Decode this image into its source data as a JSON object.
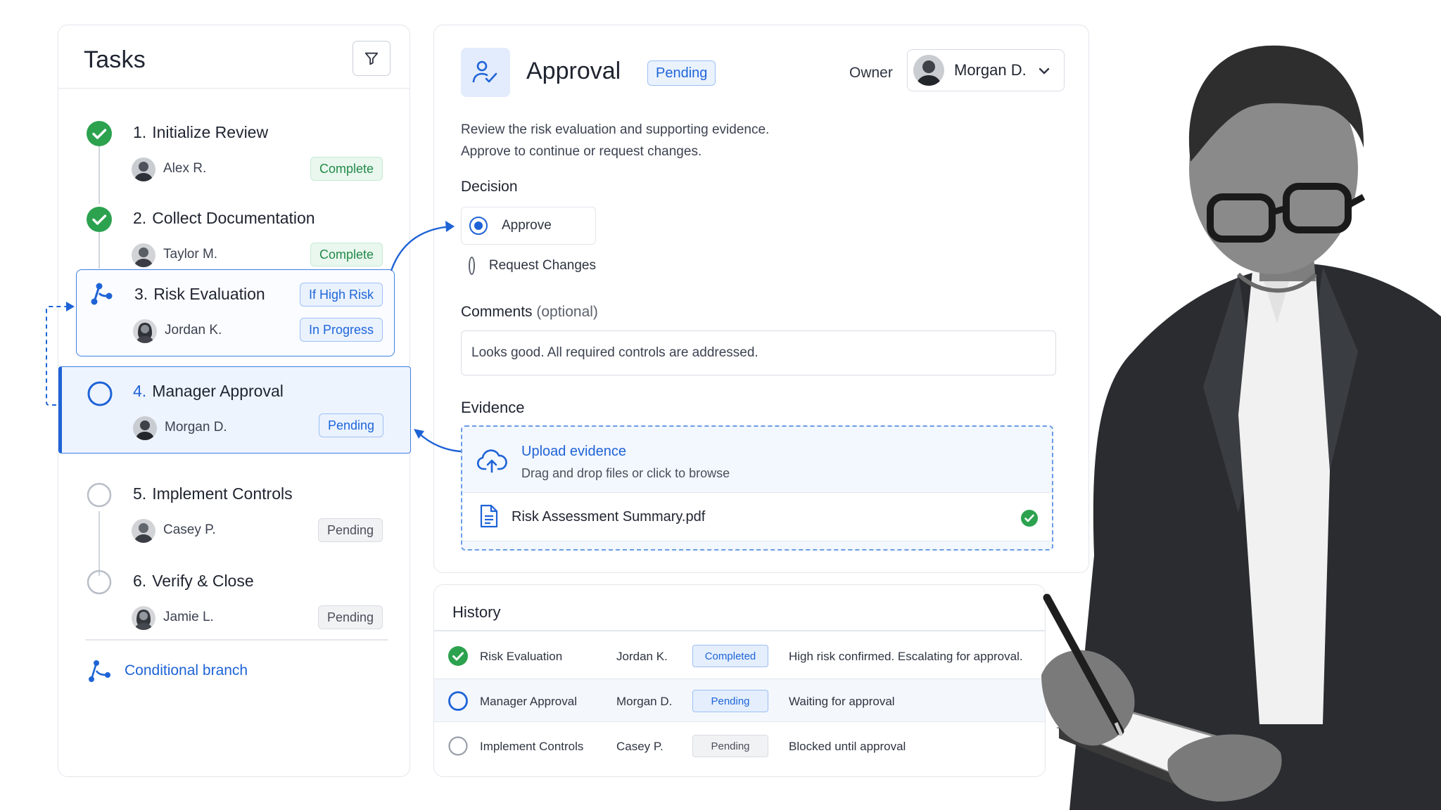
{
  "tasks": {
    "title": "Tasks",
    "items": [
      {
        "num": "1.",
        "name": "Initialize Review",
        "person": "Alex R.",
        "status": "Complete"
      },
      {
        "num": "2.",
        "name": "Collect Documentation",
        "person": "Taylor M.",
        "status": "Complete"
      },
      {
        "num": "3.",
        "name": "Risk Evaluation",
        "person": "Jordan K.",
        "condition": "If High Risk",
        "status": "In Progress"
      },
      {
        "num": "4.",
        "name": "Manager Approval",
        "person": "Morgan D.",
        "status": "Pending"
      },
      {
        "num": "5.",
        "name": "Implement Controls",
        "person": "Casey P.",
        "status": "Pending"
      },
      {
        "num": "6.",
        "name": "Verify & Close",
        "person": "Jamie L.",
        "status": "Pending"
      }
    ],
    "branch_label": "Conditional branch"
  },
  "approval": {
    "title": "Approval",
    "status": "Pending",
    "owner_label": "Owner",
    "owner": "Morgan D.",
    "description_1": "Review the risk evaluation and supporting evidence.",
    "description_2": "Approve to continue or request changes.",
    "decision_label": "Decision",
    "options": [
      "Approve",
      "Request Changes"
    ],
    "selected_option": "Approve",
    "comments_label": "Comments",
    "comments_optional": "(optional)",
    "comments_value": "Looks good. All required controls are addressed.",
    "evidence_label": "Evidence",
    "upload_title": "Upload evidence",
    "upload_hint": "Drag and drop files or click to browse",
    "file_name": "Risk Assessment Summary.pdf"
  },
  "history": {
    "title": "History",
    "rows": [
      {
        "step": "Risk Evaluation",
        "person": "Jordan K.",
        "status": "Completed",
        "note": "High risk confirmed. Escalating for approval."
      },
      {
        "step": "Manager Approval",
        "person": "Morgan D.",
        "status": "Pending",
        "note": "Waiting for approval"
      },
      {
        "step": "Implement Controls",
        "person": "Casey P.",
        "status": "Pending",
        "note": "Blocked until approval"
      }
    ]
  },
  "colors": {
    "accent": "#1e63d6",
    "success": "#2ca24f",
    "border": "#e3e6ec"
  }
}
